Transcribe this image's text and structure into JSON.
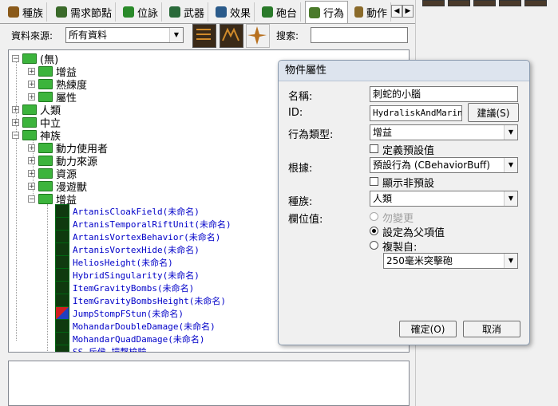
{
  "tabs": [
    {
      "label": "種族",
      "icon": "race-icon",
      "color": "#8a5a1a"
    },
    {
      "label": "需求節點",
      "icon": "requirement-icon",
      "color": "#3a6a2a"
    },
    {
      "label": "位詠",
      "icon": "weapon-effect-icon",
      "color": "#2a8a2a"
    },
    {
      "label": "武器",
      "icon": "weapon-icon",
      "color": "#2a6a3a"
    },
    {
      "label": "效果",
      "icon": "effect-icon",
      "color": "#2a5a8a"
    },
    {
      "label": "砲台",
      "icon": "turret-icon",
      "color": "#2a7a2a"
    },
    {
      "label": "行為",
      "icon": "behavior-icon",
      "color": "#4a7a2a"
    },
    {
      "label": "動作",
      "icon": "action-icon",
      "color": "#8a6a2a"
    }
  ],
  "toolbar": {
    "source_label": "資料來源:",
    "source_value": "所有資料",
    "search_label": "搜索:",
    "search_value": ""
  },
  "tree": {
    "root": "(無)",
    "root_children": [
      "增益",
      "熟練度",
      "屬性"
    ],
    "top": [
      "人類",
      "中立",
      "神族"
    ],
    "protoss_children": [
      "動力使用者",
      "動力來源",
      "資源",
      "漫遊獸",
      "增益"
    ],
    "leaves": [
      "ArtanisCloakField(未命名)",
      "ArtanisTemporalRiftUnit(未命名)",
      "ArtanisVortexBehavior(未命名)",
      "ArtanisVortexHide(未命名)",
      "HeliosHeight(未命名)",
      "HybridSingularity(未命名)",
      "ItemGravityBombs(未命名)",
      "ItemGravityBombsHeight(未命名)",
      "JumpStompFStun(未命名)",
      "MohandarDoubleDamage(未命名)",
      "MohandarQuadDamage(未命名)",
      "SS_斥侯_撞擊檢驗"
    ]
  },
  "dialog": {
    "title": "物件屬性",
    "name_label": "名稱:",
    "name_value": "刺蛇的小腦",
    "id_label": "ID:",
    "id_value": "HydraliskAndMarine",
    "suggest_button": "建議(S)",
    "behavior_type_label": "行為類型:",
    "behavior_type_value": "增益",
    "define_default_label": "定義預設值",
    "based_on_label": "根據:",
    "based_on_value": "預設行為 (CBehaviorBuff)",
    "show_non_default_label": "顯示非預設",
    "race_label": "種族:",
    "race_value": "人類",
    "field_value_label": "欄位值:",
    "radio_no_change": "勿變更",
    "radio_set_parent": "設定為父項值",
    "radio_copy_from": "複製自:",
    "copy_from_value": "250毫米突擊砲",
    "ok_button": "確定(O)",
    "cancel_button": "取消"
  }
}
